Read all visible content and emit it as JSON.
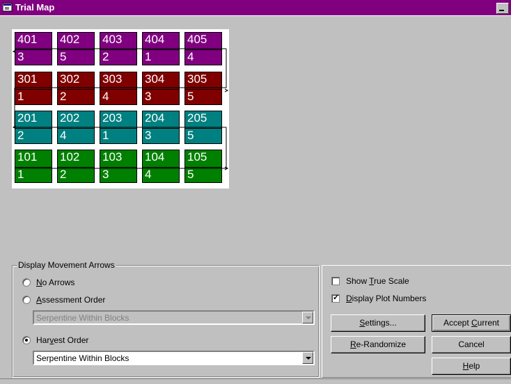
{
  "window": {
    "title": "Trial Map"
  },
  "map": {
    "rows": [
      {
        "color": "#800080",
        "plots": [
          {
            "num": "401",
            "trt": "3"
          },
          {
            "num": "402",
            "trt": "5"
          },
          {
            "num": "403",
            "trt": "2"
          },
          {
            "num": "404",
            "trt": "1"
          },
          {
            "num": "405",
            "trt": "4"
          }
        ]
      },
      {
        "color": "#800000",
        "plots": [
          {
            "num": "301",
            "trt": "1"
          },
          {
            "num": "302",
            "trt": "2"
          },
          {
            "num": "303",
            "trt": "4"
          },
          {
            "num": "304",
            "trt": "3"
          },
          {
            "num": "305",
            "trt": "5"
          }
        ]
      },
      {
        "color": "#008080",
        "plots": [
          {
            "num": "201",
            "trt": "2"
          },
          {
            "num": "202",
            "trt": "4"
          },
          {
            "num": "203",
            "trt": "1"
          },
          {
            "num": "204",
            "trt": "3"
          },
          {
            "num": "205",
            "trt": "5"
          }
        ]
      },
      {
        "color": "#008000",
        "plots": [
          {
            "num": "101",
            "trt": "1"
          },
          {
            "num": "102",
            "trt": "2"
          },
          {
            "num": "103",
            "trt": "3"
          },
          {
            "num": "104",
            "trt": "4"
          },
          {
            "num": "105",
            "trt": "5"
          }
        ]
      }
    ]
  },
  "arrows": {
    "legend": "Display Movement Arrows",
    "no_arrows": {
      "label": "No Arrows",
      "selected": false
    },
    "assessment": {
      "label": "Assessment Order",
      "selected": false,
      "combo_value": "Serpentine Within Blocks",
      "enabled": false
    },
    "harvest": {
      "label": "Harvest Order",
      "selected": true,
      "combo_value": "Serpentine Within Blocks",
      "enabled": true
    }
  },
  "options": {
    "show_true_scale": {
      "label": "Show True Scale",
      "checked": false
    },
    "display_plot_numbers": {
      "label": "Display Plot Numbers",
      "checked": true
    }
  },
  "buttons": {
    "settings": "Settings...",
    "accept_current": "Accept Current",
    "re_randomize": "Re-Randomize",
    "cancel": "Cancel",
    "help": "Help"
  }
}
